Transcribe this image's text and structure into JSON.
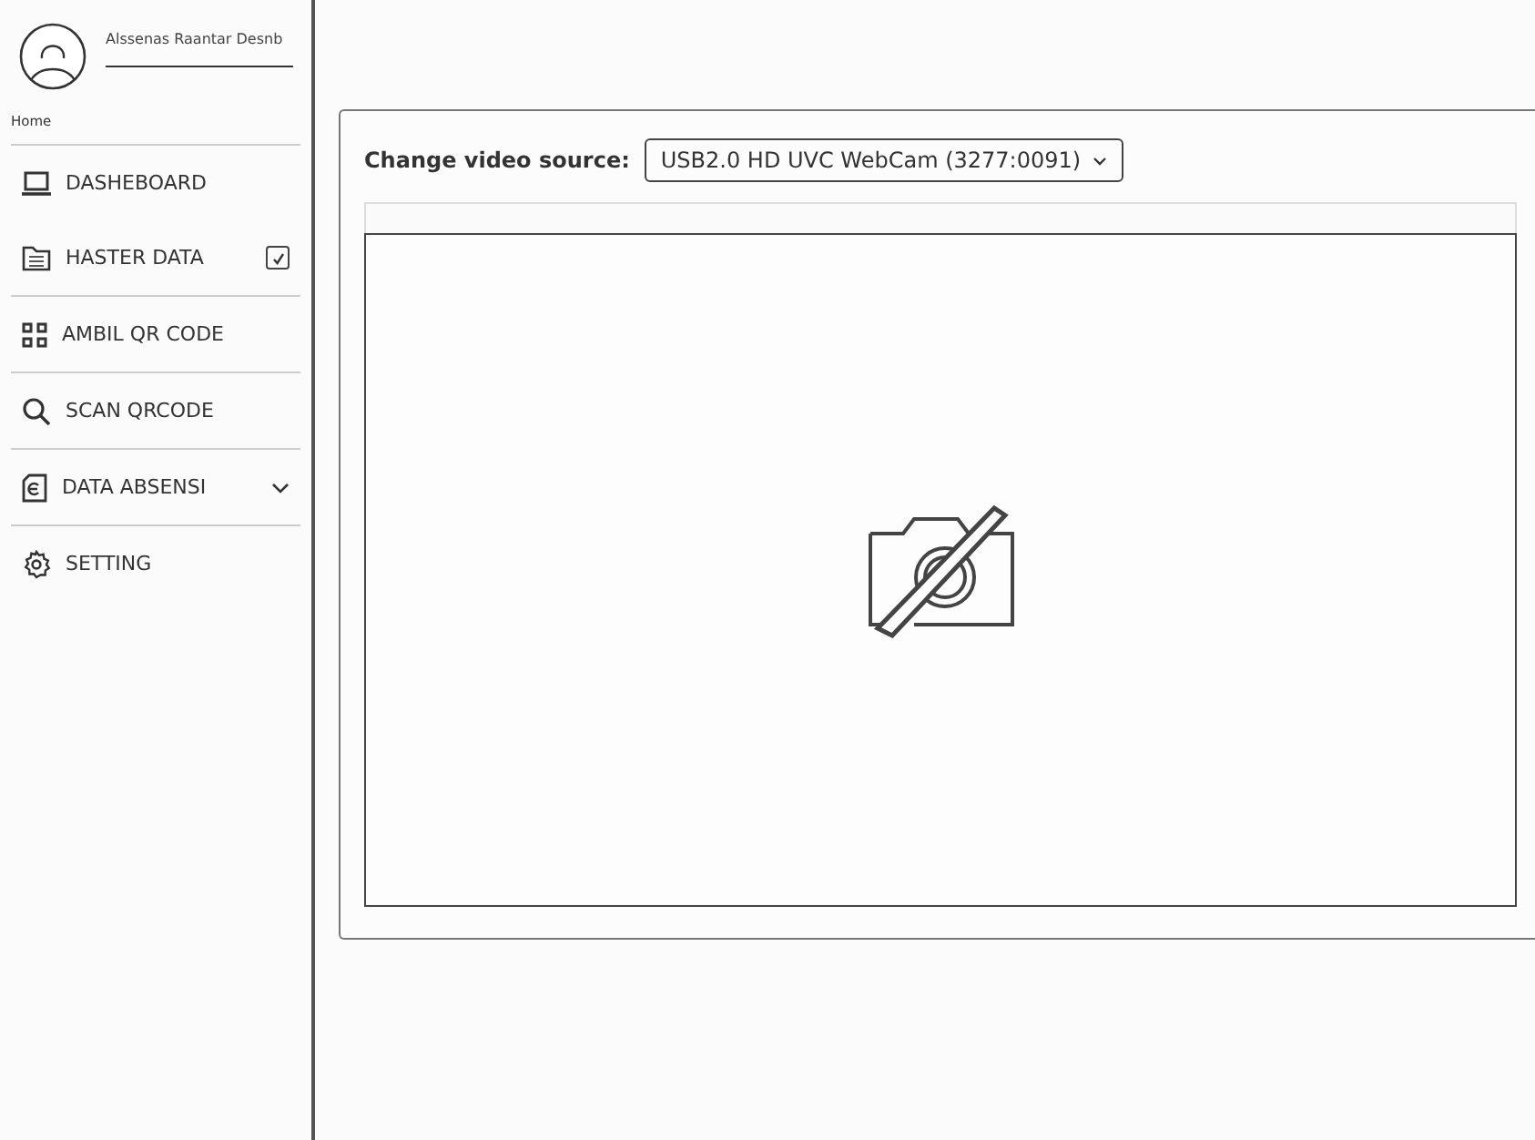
{
  "sidebar": {
    "user_name": "Alssenas Raantar Desnb",
    "home_label": "Home",
    "items": [
      {
        "kind": "laptop",
        "label": "DASHEBOARD"
      },
      {
        "kind": "folder",
        "label": "HASTER DATA",
        "checked": true
      },
      {
        "kind": "grid",
        "label": "AMBIL QR CODE"
      },
      {
        "kind": "search",
        "label": "SCAN QRCODE"
      },
      {
        "kind": "document",
        "label": "DATA ABSENSI",
        "expanded": false
      },
      {
        "kind": "gear",
        "label": "SETTING"
      }
    ]
  },
  "camera": {
    "source_label": "Change video source:",
    "source_value": "USB2.0 HD UVC WebCam (3277:0091)",
    "camera_off": true
  }
}
